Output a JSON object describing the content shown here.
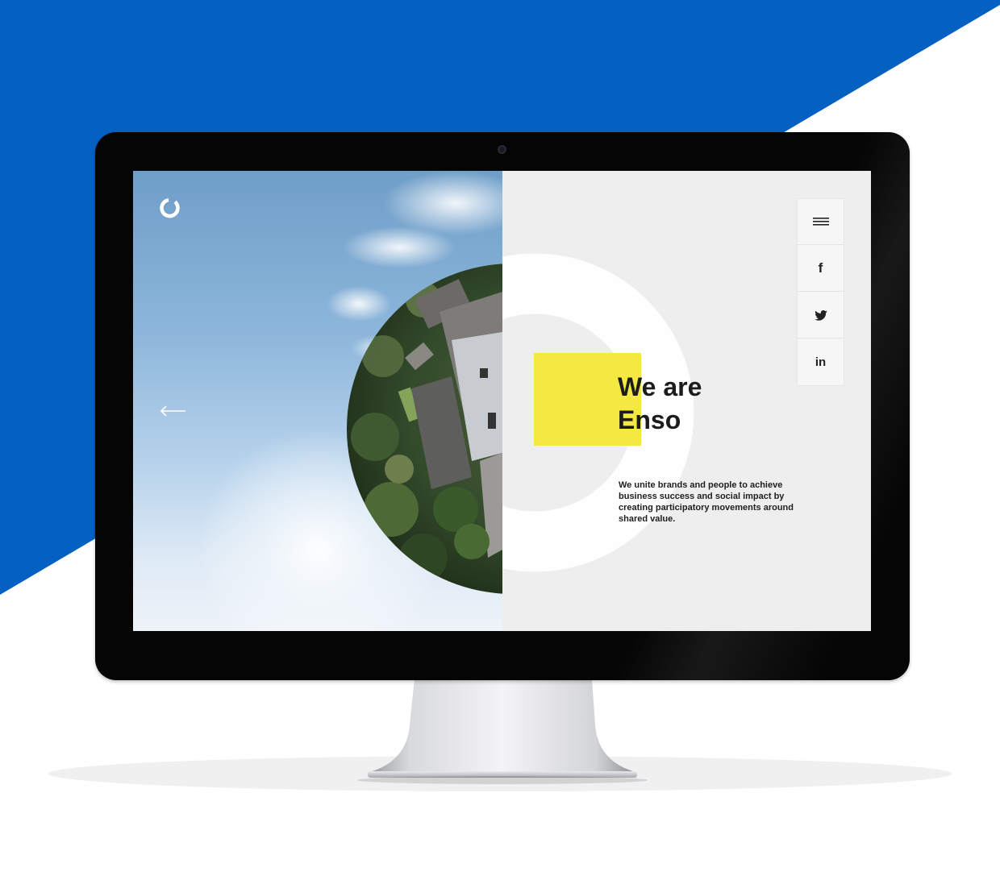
{
  "colors": {
    "brand_blue": "#0461c2",
    "highlight_yellow": "#f4e940",
    "screen_background": "#eeeeee",
    "text_dark": "#1c1c1c"
  },
  "site": {
    "logo_icon": "enso-circle-logo-icon",
    "back_icon": "arrow-left-icon",
    "headline_line1": "We are",
    "headline_line2": "Enso",
    "description": "We unite brands and people to achieve business success and social impact by creating participatory movements around shared value.",
    "menu": [
      {
        "icon": "hamburger-menu-icon",
        "label": ""
      },
      {
        "icon": "facebook-icon",
        "label": "f"
      },
      {
        "icon": "twitter-icon",
        "label": ""
      },
      {
        "icon": "linkedin-icon",
        "label": "in"
      }
    ]
  }
}
